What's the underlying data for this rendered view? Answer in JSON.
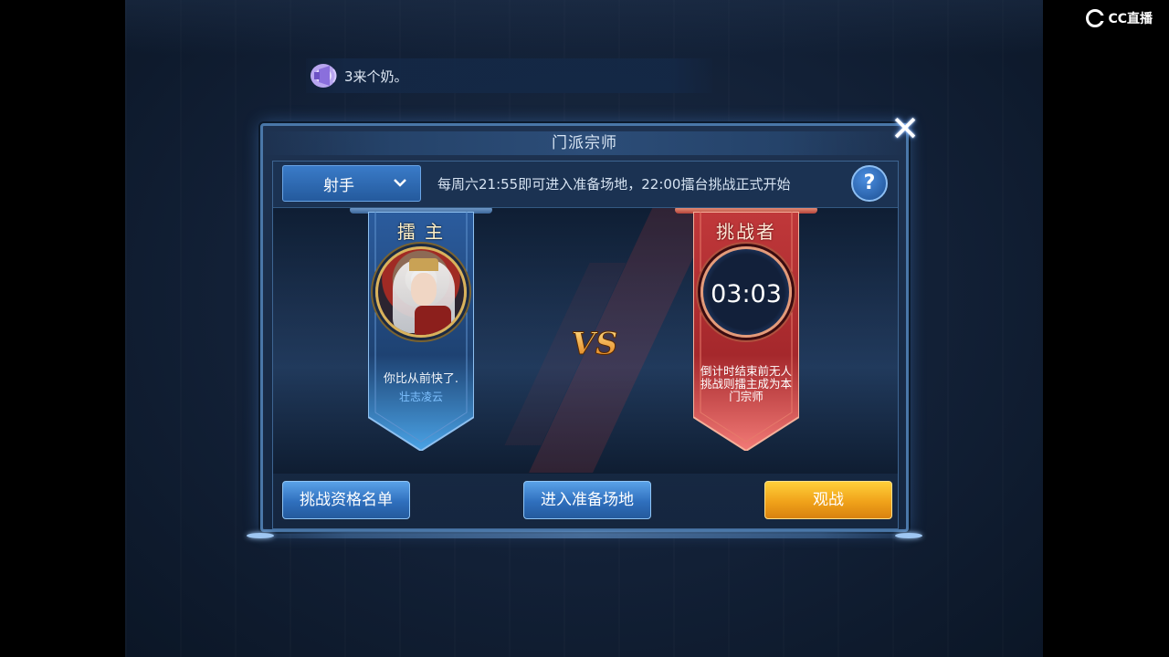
{
  "watermark": {
    "text": "CC直播"
  },
  "chat": {
    "icon": "loudspeaker-icon",
    "message": "3来个奶。"
  },
  "dialog": {
    "title": "门派宗师",
    "close_icon": "close-icon",
    "class_select": {
      "selected": "射手"
    },
    "notice": "每周六21:55即可进入准备场地，22:00擂台挑战正式开始",
    "help_label": "?",
    "host": {
      "title": "擂 主",
      "quote": "你比从前快了.",
      "name": "壮志凌云"
    },
    "vs_label": "VS",
    "challenger": {
      "title": "挑战者",
      "countdown": "03:03",
      "description": "倒计时结束前无人挑战则擂主成为本门宗师"
    },
    "buttons": {
      "qualification_list": "挑战资格名单",
      "enter_prep": "进入准备场地",
      "spectate": "观战"
    }
  },
  "colors": {
    "accent_blue": "#2f6fbd",
    "gold": "#f0a21a",
    "host_banner": "#2b5c9e",
    "challenger_banner": "#c0383a"
  }
}
